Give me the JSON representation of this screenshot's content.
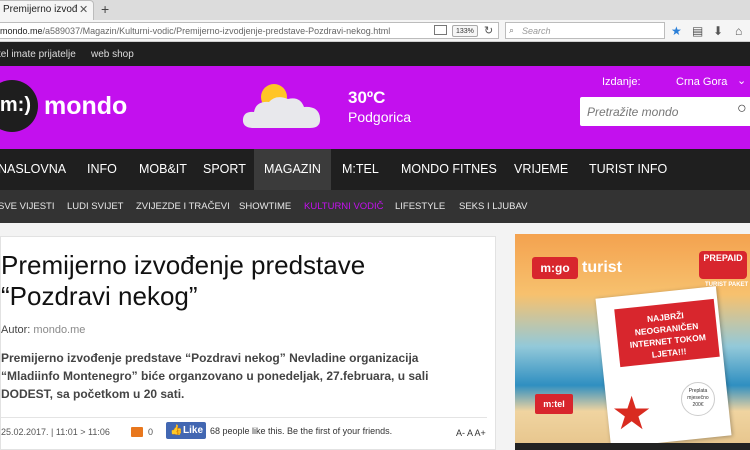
{
  "browser": {
    "tab_title": "Premijerno izvođenje predst",
    "url_host": "mondo.me",
    "url_path": "/a589037/Magazin/Kulturni-vodic/Premijerno-izvodjenje-predstave-Pozdravi-nekog.html",
    "zoom": "133%",
    "search_placeholder": "Search"
  },
  "topbar": {
    "links": [
      "tel imate prijatelje",
      "web shop"
    ]
  },
  "header": {
    "logo_mark": "m:)",
    "logo_text": "mondo",
    "weather": {
      "temperature": "30ºC",
      "city": "Podgorica",
      "icon": "partly-cloudy-icon"
    },
    "edition_label": "Izdanje:",
    "edition_value": "Crna Gora",
    "search_placeholder": "Pretražite mondo"
  },
  "main_nav": {
    "items": [
      "NASLOVNA",
      "INFO",
      "MOB&IT",
      "SPORT",
      "MAGAZIN",
      "M:TEL",
      "MONDO FITNES",
      "VRIJEME",
      "TURIST INFO"
    ],
    "active": "MAGAZIN"
  },
  "sub_nav": {
    "items": [
      "SVE VIJESTI",
      "LUDI SVIJET",
      "ZVIJEZDE I TRAČEVI",
      "SHOWTIME",
      "KULTURNI VODIČ",
      "LIFESTYLE",
      "SEKS I LJUBAV"
    ],
    "active": "KULTURNI VODIČ"
  },
  "article": {
    "title": "Premijerno izvođenje predstave “Pozdravi nekog”",
    "author_label": "Autor:",
    "author": "mondo.me",
    "lead": "Premijerno izvođenje predstave “Pozdravi nekog” Nevladine organizacija “Mladiinfo Montenegro” biće organzovano u ponedeljak, 27.februara, u sali DODEST, sa početkom u 20 sati.",
    "date": "25.02.2017. | 11:01 > 11:06",
    "comments": "0",
    "like_label": "Like",
    "like_text": "68 people like this. Be the first of your friends.",
    "font_controls": "A- A A+"
  },
  "ad": {
    "brand": "m:go",
    "product": "turist",
    "prepaid": "PREPAID",
    "prepaid_sub": "TURIST PAKET",
    "banner": "NAJBRŽI NEOGRANIČEN INTERNET TOKOM LJETA!!!",
    "price": "Preplata mjesečno 200€",
    "operator": "m:tel"
  },
  "colors": {
    "brand_purple": "#c310ee",
    "active_subnav": "#c310ee",
    "dark_bar": "#1f1f1f",
    "accent_red": "#d8262d"
  }
}
